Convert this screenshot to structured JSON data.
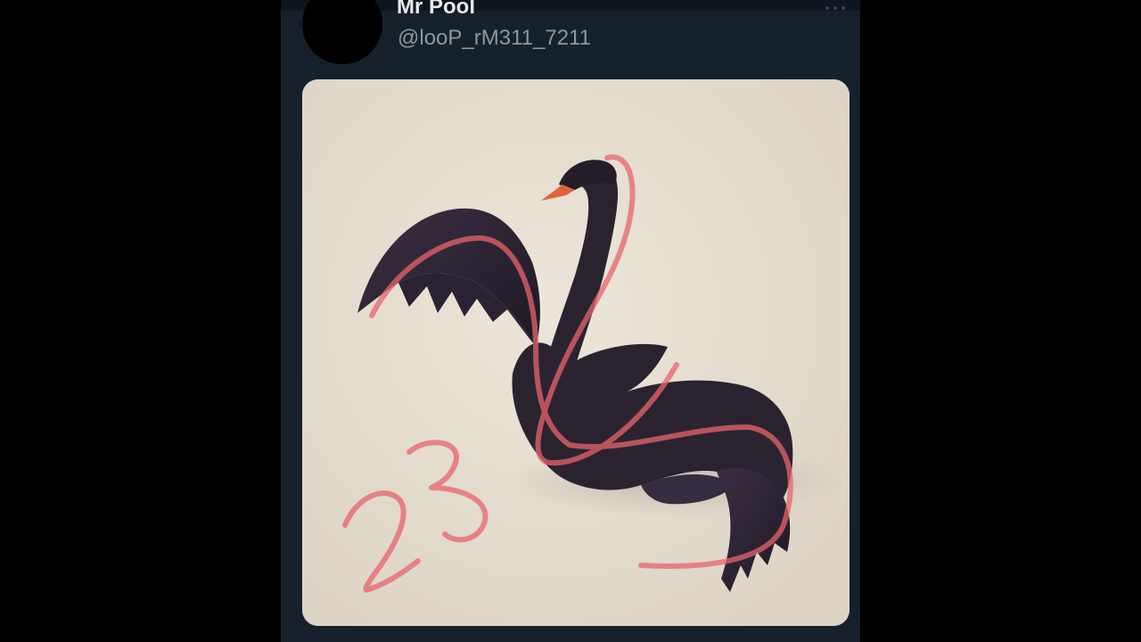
{
  "tweet": {
    "author": {
      "display_name": "Mr Pool",
      "handle": "@looP_rM311_7211"
    },
    "menu_icon": "more-horizontal-icon",
    "media": {
      "subject": "black-swan-illustration",
      "annotation_number": "23",
      "colors": {
        "background": "#e6ded0",
        "swan": "#2b2230",
        "beak": "#e0633a",
        "annotation_stroke": "#e8646c"
      }
    }
  },
  "theme": {
    "page_background": "#000000",
    "card_background": "#15202b",
    "name_color": "#e7e9ea",
    "handle_color": "#8b98a5"
  }
}
